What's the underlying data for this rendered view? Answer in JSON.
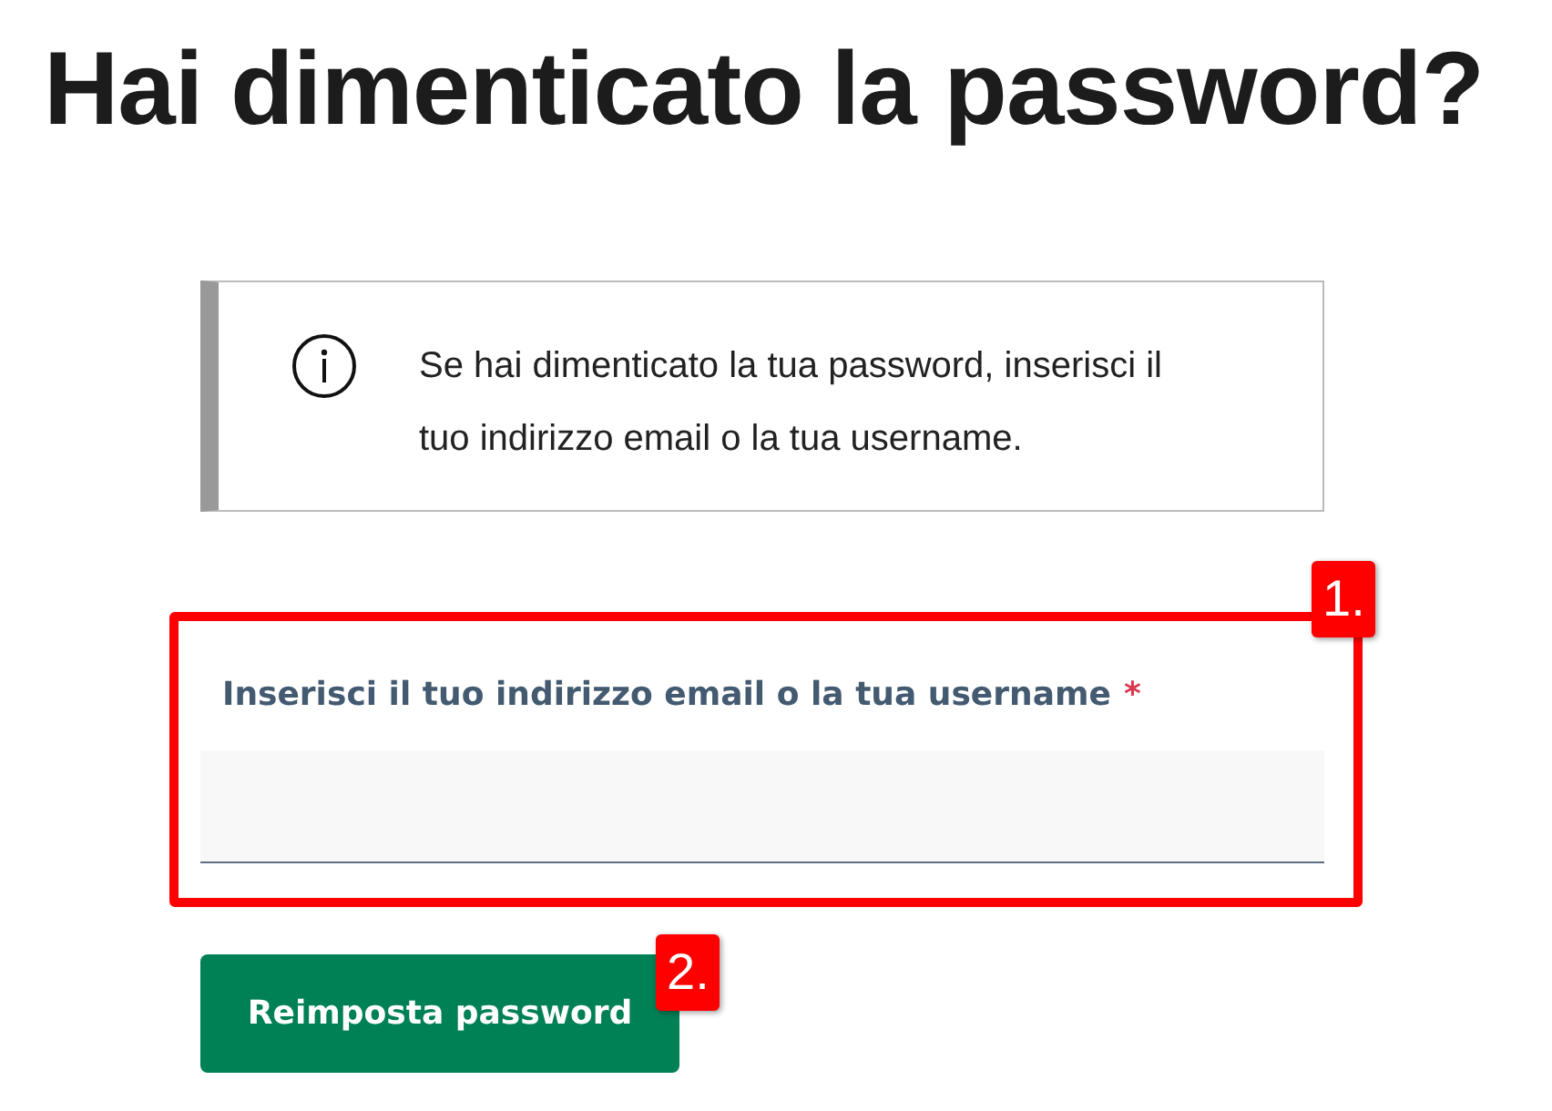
{
  "title": "Hai dimenticato la password?",
  "notice": {
    "text": "Se hai dimenticato la tua password, inserisci il tuo indirizzo email o la tua username."
  },
  "field": {
    "label": "Inserisci il tuo indirizzo email o la tua username",
    "required_mark": "*",
    "annotation": {
      "label": "1.",
      "framed": true
    }
  },
  "button": {
    "label": "Reimposta password",
    "annotation": {
      "label": "2.",
      "framed": false
    }
  }
}
